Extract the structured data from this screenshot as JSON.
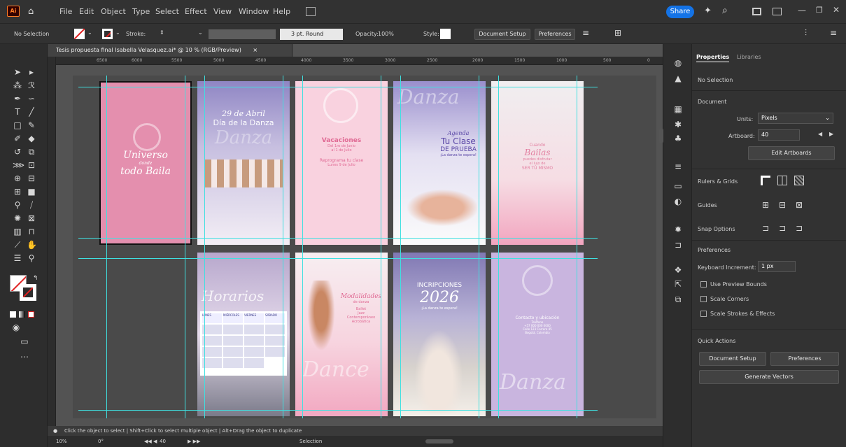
{
  "app": {
    "logo": "Ai",
    "share_label": "Share"
  },
  "menu": [
    "File",
    "Edit",
    "Object",
    "Type",
    "Select",
    "Effect",
    "View",
    "Window",
    "Help"
  ],
  "control_bar": {
    "selection_label": "No Selection",
    "stroke_label": "Stroke:",
    "stroke_profile": "3 pt. Round",
    "opacity_label": "Opacity:",
    "opacity_value": "100%",
    "style_label": "Style:",
    "doc_setup": "Document Setup",
    "preferences": "Preferences"
  },
  "doc_tab": {
    "title": "Tesis propuesta final Isabella Velasquez.ai* @ 10 % (RGB/Preview)",
    "close": "×"
  },
  "ruler_ticks": [
    "6500",
    "6000",
    "5500",
    "5000",
    "4500",
    "4000",
    "3500",
    "3000",
    "2500",
    "2000",
    "1500",
    "1000",
    "500",
    "0"
  ],
  "status": {
    "hint": "Click the object to select | Shift+Click to select multiple object | Alt+Drag the object to duplicate",
    "zoom": "10%",
    "rotation": "0°",
    "artboard_num": "40",
    "tool_name": "Selection"
  },
  "artboards": {
    "a1": {
      "l1": "Universo",
      "l2": "donde",
      "l3": "todo Baila"
    },
    "a2": {
      "date": "29 de Abril",
      "title": "Día de la Danza",
      "script": "Danza"
    },
    "a3": {
      "title": "Vacaciones",
      "sub1": "Del 1ro de Junio",
      "sub2": "al 1 de Julio",
      "line1": "Reprograma tu clase",
      "line2": "Lunes 9 de Julio"
    },
    "a4": {
      "script": "Danza",
      "kicker": "Agenda",
      "t1": "Tu Clase",
      "t2": "DE PRUEBA",
      "t3": "¡La danza te espera!"
    },
    "a5": {
      "l1": "Cuando",
      "l2": "Bailas",
      "l3": "puedes disfrutar",
      "l4": "el lujo de",
      "l5": "SER TÚ MISMO"
    },
    "a6": {
      "title": "Horarios",
      "days": [
        "LUNES",
        "MIÉRCOLES",
        "VIERNES",
        "SÁBADO"
      ]
    },
    "a7": {
      "title1": "Modalidades",
      "title2": "de danza",
      "items": [
        "Ballet",
        "Jazz",
        "Contemporáneo",
        "Acrobática"
      ],
      "script": "Dance"
    },
    "a8": {
      "t1": "INCRIPCIONES",
      "t2": "2026",
      "t3": "¡La danza te espera!"
    },
    "a9": {
      "title": "Contacto y ubicación",
      "lines": [
        "Teléfono",
        "+57 000 000 0000",
        "Calle 123 Carrera 45",
        "Bogotá, Colombia"
      ],
      "script": "Danza"
    }
  },
  "panel": {
    "tabs": [
      "Properties",
      "Libraries"
    ],
    "selection": "No Selection",
    "document": "Document",
    "units_label": "Units:",
    "units_value": "Pixels",
    "artboard_label": "Artboard:",
    "artboard_value": "40",
    "edit_artboards": "Edit Artboards",
    "rulers": "Rulers & Grids",
    "guides": "Guides",
    "snap": "Snap Options",
    "preferences": "Preferences",
    "kb_label": "Keyboard Increment:",
    "kb_value": "1 px",
    "cb1": "Use Preview Bounds",
    "cb2": "Scale Corners",
    "cb3": "Scale Strokes & Effects",
    "quick": "Quick Actions",
    "qa_doc": "Document Setup",
    "qa_pref": "Preferences",
    "qa_gen": "Generate Vectors"
  }
}
